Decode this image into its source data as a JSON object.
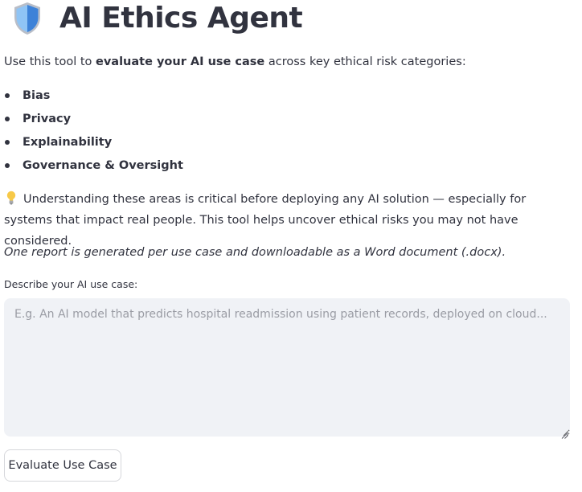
{
  "header": {
    "icon": "shield-icon",
    "title": "AI Ethics Agent"
  },
  "intro": {
    "prefix": "Use this tool to ",
    "bold": "evaluate your AI use case",
    "suffix": " across key ethical risk categories:"
  },
  "categories": [
    "Bias",
    "Privacy",
    "Explainability",
    "Governance & Oversight"
  ],
  "note": {
    "icon": "lightbulb-icon",
    "text": "Understanding these areas is critical before deploying any AI solution — especially for systems that impact real people. This tool helps uncover ethical risks you may not have considered."
  },
  "report_note": "One report is generated per use case and downloadable as a Word document (.docx).",
  "use_case_field": {
    "label": "Describe your AI use case:",
    "value": "",
    "placeholder": "E.g. An AI model that predicts hospital readmission using patient records, deployed on cloud..."
  },
  "actions": {
    "evaluate_label": "Evaluate Use Case"
  },
  "colors": {
    "text": "#31333f",
    "input_background": "#f0f2f6",
    "placeholder": "#9a9ca4",
    "shield_light": "#8fc4f5",
    "shield_dark": "#3d82d8"
  }
}
